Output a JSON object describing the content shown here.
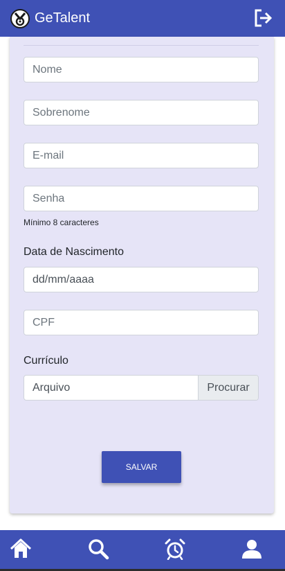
{
  "app": {
    "title": "GeTalent"
  },
  "form": {
    "name_placeholder": "Nome",
    "surname_placeholder": "Sobrenome",
    "email_placeholder": "E-mail",
    "password_placeholder": "Senha",
    "password_hint": "Mínimo 8 caracteres",
    "birthdate_label": "Data de Nascimento",
    "birthdate_value": "dd/mm/aaaa",
    "cpf_placeholder": "CPF",
    "resume_label": "Currículo",
    "file_placeholder": "Arquivo",
    "browse_label": "Procurar",
    "save_label": "SALVAR"
  },
  "colors": {
    "primary": "#3f51b5",
    "card_background": "#e6e4f7"
  },
  "bottom_nav": {
    "items": [
      {
        "icon": "home-icon"
      },
      {
        "icon": "search-icon"
      },
      {
        "icon": "alarm-clock-icon"
      },
      {
        "icon": "user-icon"
      }
    ]
  }
}
